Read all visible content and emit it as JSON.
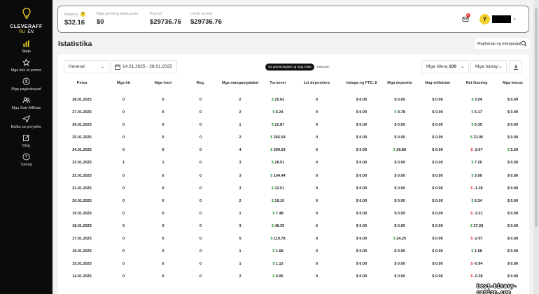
{
  "brand": {
    "name": "CLEVERAFF",
    "langs": [
      "RU",
      "EN"
    ]
  },
  "sidebar": {
    "items": [
      {
        "label": "Stats",
        "icon": "stats-icon"
      },
      {
        "label": "Mga link at promo",
        "icon": "star-icon"
      },
      {
        "label": "Mga pagbabayad",
        "icon": "dollar-icon"
      },
      {
        "label": "Mga Sub-Affiliate",
        "icon": "users-icon"
      },
      {
        "label": "Balita sa proyekto",
        "icon": "send-icon"
      },
      {
        "label": "Blog",
        "icon": "edit-icon"
      },
      {
        "label": "Tulong",
        "icon": "help-icon"
      }
    ]
  },
  "header": {
    "metrics": [
      {
        "label": "Balance",
        "value": "$32.16"
      },
      {
        "label": "Mga pending babayaran",
        "value": "$0"
      },
      {
        "label": "Payout",
        "value": "$29736.76"
      },
      {
        "label": "Lahat ng kita",
        "value": "$29736.76"
      }
    ],
    "notification_count": "0",
    "avatar_letter": "Y"
  },
  "page": {
    "title": "Istatistika",
    "search_label": "Maghanap ng mangangal"
  },
  "filters": {
    "group": "Heneral",
    "date_range": "14.01.2025 - 28.01.2025",
    "toggle_on": "Sa pamamagitan ng mga Araw",
    "toggle_off": "Kabuuan",
    "rows_label": "Mga hilera",
    "rows_value": "100",
    "columns_label": "Mga hanay"
  },
  "table": {
    "columns": [
      "Petsa",
      "Mga hit",
      "Mga host",
      "Reg.",
      "Mga mangangalakal",
      "Turnover",
      "1st depositors",
      "halaga ng FTD, $",
      "Mga deposito",
      "Nag-withdraw",
      "Net Gaming",
      "Mga bonus"
    ],
    "rows": [
      [
        "28.01.2025",
        "0",
        "0",
        "0",
        "2",
        "$ 25.62",
        "0",
        "$ 0.00",
        "$ 0.00",
        "$ 0.00",
        "$ 3.04",
        "$ 0.00"
      ],
      [
        "27.01.2025",
        "0",
        "0",
        "0",
        "2",
        "$ 6.24",
        "0",
        "$ 0.00",
        "$ 9.78",
        "$ 0.00",
        "$ 5.17",
        "$ 0.00"
      ],
      [
        "26.01.2025",
        "0",
        "0",
        "0",
        "1",
        "$ 22.87",
        "0",
        "$ 0.00",
        "$ 0.00",
        "$ 0.00",
        "$ 6.35",
        "$ 0.00"
      ],
      [
        "25.01.2025",
        "0",
        "0",
        "0",
        "2",
        "$ 266.54",
        "0",
        "$ 0.00",
        "$ 0.00",
        "$ 0.00",
        "$ 22.95",
        "$ 0.00"
      ],
      [
        "24.01.2025",
        "0",
        "0",
        "0",
        "4",
        "$ 299.03",
        "0",
        "$ 0.00",
        "$ 29.85",
        "$ 0.00",
        "$ -2.97",
        "$ 5.29"
      ],
      [
        "23.01.2025",
        "1",
        "1",
        "0",
        "3",
        "$ 28.51",
        "0",
        "$ 0.00",
        "$ 0.00",
        "$ 0.00",
        "$ 7.26",
        "$ 0.00"
      ],
      [
        "22.01.2025",
        "0",
        "0",
        "0",
        "3",
        "$ 104.44",
        "0",
        "$ 0.00",
        "$ 0.00",
        "$ 0.00",
        "$ 3.06",
        "$ 0.00"
      ],
      [
        "21.01.2025",
        "0",
        "0",
        "0",
        "3",
        "$ 32.51",
        "0",
        "$ 0.00",
        "$ 0.00",
        "$ 0.00",
        "$ -1.28",
        "$ 0.00"
      ],
      [
        "20.01.2025",
        "0",
        "0",
        "0",
        "2",
        "$ 19.10",
        "0",
        "$ 0.00",
        "$ 0.00",
        "$ 0.00",
        "$ 6.34",
        "$ 0.00"
      ],
      [
        "19.01.2025",
        "0",
        "0",
        "0",
        "1",
        "$ 7.48",
        "0",
        "$ 0.00",
        "$ 0.00",
        "$ 0.00",
        "$ -3.21",
        "$ 0.00"
      ],
      [
        "18.01.2025",
        "0",
        "0",
        "0",
        "3",
        "$ 48.39",
        "0",
        "$ 0.00",
        "$ 0.00",
        "$ 0.00",
        "$ 27.28",
        "$ 0.00"
      ],
      [
        "17.01.2025",
        "0",
        "0",
        "0",
        "5",
        "$ 119.78",
        "0",
        "$ 0.00",
        "$ 24.25",
        "$ 0.00",
        "$ -2.97",
        "$ 0.00"
      ],
      [
        "16.01.2025",
        "0",
        "0",
        "0",
        "1",
        "$ 1.68",
        "0",
        "$ 0.00",
        "$ 0.00",
        "$ 0.00",
        "$ 1.68",
        "$ 0.00"
      ],
      [
        "15.01.2025",
        "0",
        "0",
        "0",
        "1",
        "$ 1.12",
        "0",
        "$ 0.00",
        "$ 0.00",
        "$ 0.00",
        "$ -0.94",
        "$ 0.00"
      ],
      [
        "14.01.2025",
        "0",
        "0",
        "0",
        "2",
        "$ 4.95",
        "0",
        "$ 0.00",
        "$ 0.00",
        "$ 0.00",
        "$ -0.38",
        "$ 0.00"
      ]
    ]
  },
  "watermark": "best-binary-option.com",
  "colors": {
    "accent": "#f2d02e",
    "positive": "#2e9d3a",
    "negative": "#e53935",
    "sidebar": "#0b0b0b"
  }
}
